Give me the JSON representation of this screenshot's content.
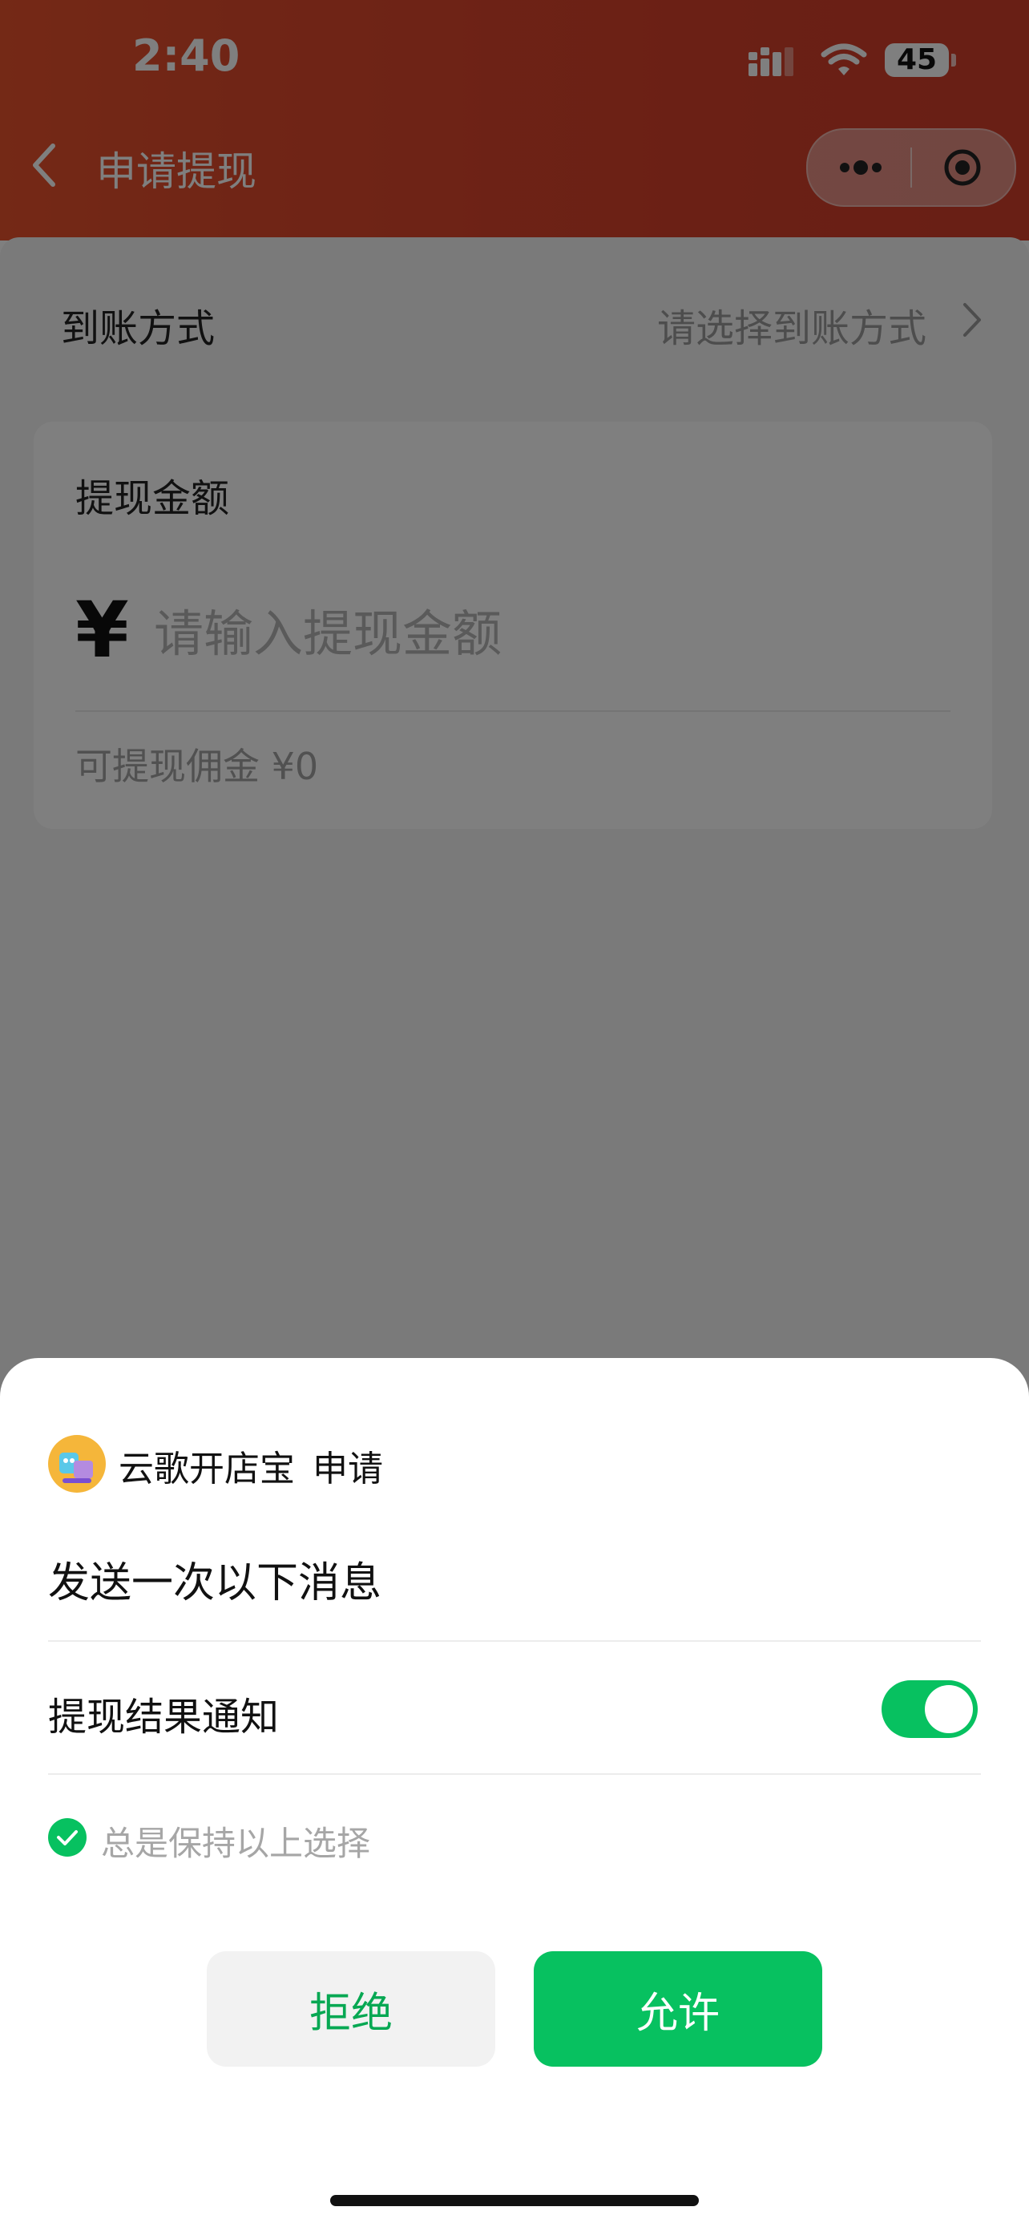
{
  "status_bar": {
    "time": "2:40",
    "battery": "45"
  },
  "nav": {
    "title": "申请提现"
  },
  "withdraw_form": {
    "method_label": "到账方式",
    "method_value": "请选择到账方式",
    "amount_title": "提现金额",
    "currency_symbol": "¥",
    "amount_placeholder": "请输入提现金额",
    "amount_value": "",
    "available_label": "可提现佣金 ¥0"
  },
  "permission_sheet": {
    "app_name": "云歌开店宝",
    "request_word": "申请",
    "heading": "发送一次以下消息",
    "subscription_label": "提现结果通知",
    "subscription_enabled": true,
    "keep_choice_label": "总是保持以上选择",
    "keep_choice_checked": true,
    "reject_label": "拒绝",
    "allow_label": "允许"
  },
  "colors": {
    "header_accent": "#e04a2c",
    "wechat_green": "#07c160",
    "reject_text": "#07a853"
  },
  "icons": {
    "back": "chevron-left-icon",
    "more": "more-dots-icon",
    "close": "target-close-icon",
    "method_arrow": "chevron-right-icon",
    "keep_check": "check-circle-icon"
  }
}
